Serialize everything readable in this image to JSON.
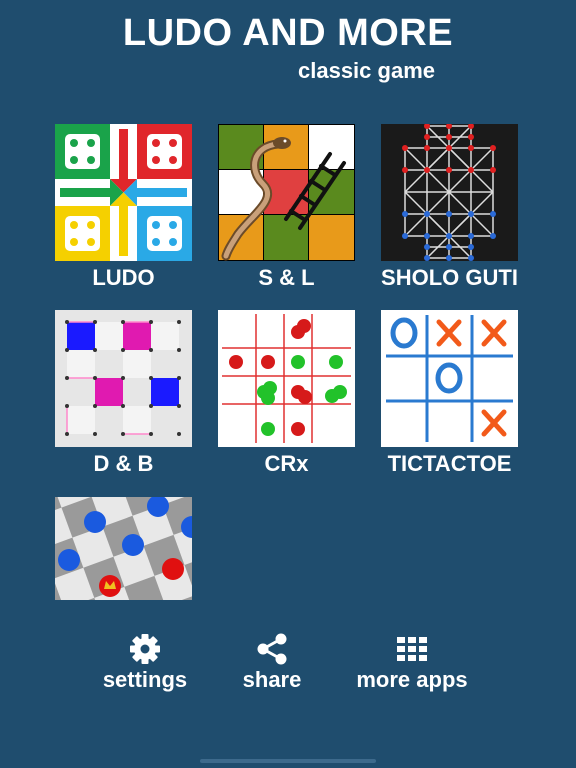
{
  "header": {
    "title": "LUDO AND MORE",
    "subtitle": "classic game"
  },
  "games": [
    {
      "label": "LUDO",
      "icon": "ludo-board"
    },
    {
      "label": "S & L",
      "icon": "snakes-and-ladders-board"
    },
    {
      "label": "SHOLO GUTI",
      "icon": "sholo-guti-board"
    },
    {
      "label": "D & B",
      "icon": "dots-and-boxes-board"
    },
    {
      "label": "CRx",
      "icon": "crossword-marbles-board"
    },
    {
      "label": "TICTACTOE",
      "icon": "tictactoe-board"
    },
    {
      "label": "",
      "icon": "checkers-board"
    }
  ],
  "toolbar": {
    "settings_label": "settings",
    "share_label": "share",
    "more_apps_label": "more apps"
  },
  "colors": {
    "background": "#1f4d6e",
    "text": "#ffffff"
  }
}
